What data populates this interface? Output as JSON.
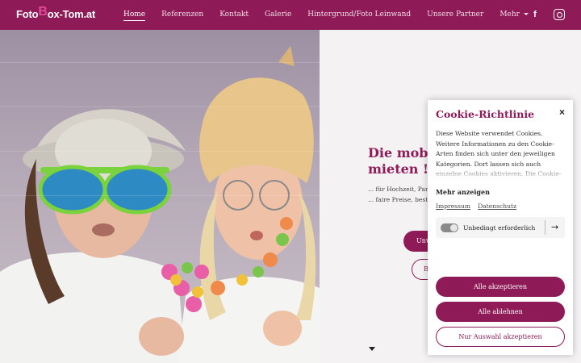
{
  "header": {
    "logo": {
      "part1": "Foto",
      "part2": "B",
      "part3": "ox-Tom.at"
    },
    "nav": [
      {
        "label": "Home",
        "active": true
      },
      {
        "label": "Referenzen"
      },
      {
        "label": "Kontakt"
      },
      {
        "label": "Galerie"
      },
      {
        "label": "Hintergrund/Foto Leinwand"
      },
      {
        "label": "Unsere Partner"
      },
      {
        "label": "Mehr",
        "dropdown": true
      }
    ],
    "social": {
      "facebook": "f",
      "instagram_icon": "instagram-icon"
    }
  },
  "hero": {
    "headline_line1": "Die mobile",
    "headline_line2": "mieten !",
    "sub_line1": "... für Hochzeit, Party",
    "sub_line2": "... faire Preise, beste B",
    "button1": "Unv",
    "button2": "B"
  },
  "cookie": {
    "title": "Cookie-Richtlinie",
    "close": "×",
    "text": "Diese Website verwendet Cookies. Weitere Informationen zu den Cookie-Arten finden sich unter den jeweiligen Kategorien. Dort lassen sich auch einzelne Cookies aktivieren. Die Cookie-Einstellungen können jederzeit",
    "more_label": "Mehr anzeigen",
    "link_impressum": "Impressum",
    "link_datenschutz": "Datenschutz",
    "toggle_label": "Unbedingt erforderlich",
    "toggle_arrow": "→",
    "accept_all": "Alle akzeptieren",
    "reject_all": "Alle ablehnen",
    "accept_selection": "Nur Auswahl akzeptieren"
  },
  "colors": {
    "brand": "#8e1a57",
    "logo_accent": "#e24a9a"
  }
}
